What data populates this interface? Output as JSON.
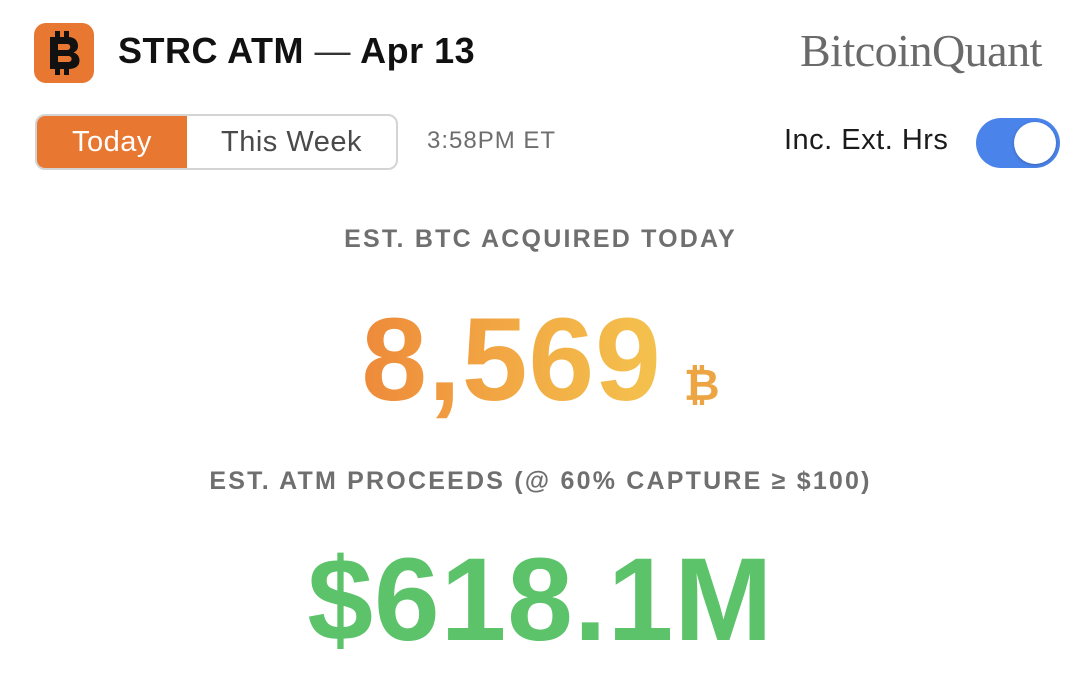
{
  "header": {
    "app_icon": "bitcoin-icon",
    "title": "STRC ATM",
    "dash": "—",
    "date": "Apr 13",
    "brand": "BitcoinQuant"
  },
  "controls": {
    "tabs": [
      {
        "label": "Today",
        "selected": true
      },
      {
        "label": "This Week",
        "selected": false
      }
    ],
    "time": "3:58PM ET",
    "toggle_label": "Inc. Ext. Hrs",
    "toggle_on": true
  },
  "metrics": {
    "btc_label": "EST. BTC ACQUIRED TODAY",
    "btc_value": "8,569",
    "btc_symbol": "₿",
    "proceeds_label": "EST. ATM PROCEEDS (@ 60% CAPTURE ≥ $100)",
    "proceeds_value": "$618.1M"
  },
  "colors": {
    "accent_orange": "#e87732",
    "toggle_blue": "#4a84ea",
    "btc_gradient_start": "#ee8a3a",
    "btc_gradient_end": "#f4c24e",
    "proceeds_green": "#5cc36b",
    "label_gray": "#6f6f6f"
  }
}
